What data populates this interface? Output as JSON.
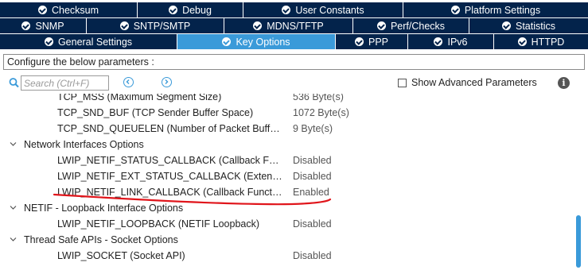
{
  "tabs": {
    "row1": [
      {
        "label": "Checksum"
      },
      {
        "label": "Debug"
      },
      {
        "label": "User Constants"
      },
      {
        "label": "Platform Settings"
      }
    ],
    "row2": [
      {
        "label": "SNMP"
      },
      {
        "label": "SNTP/SMTP"
      },
      {
        "label": "MDNS/TFTP"
      },
      {
        "label": "Perf/Checks"
      },
      {
        "label": "Statistics"
      }
    ],
    "row3": [
      {
        "label": "General Settings"
      },
      {
        "label": "Key Options"
      },
      {
        "label": "PPP"
      },
      {
        "label": "IPv6"
      },
      {
        "label": "HTTPD"
      }
    ],
    "active": "Key Options"
  },
  "configure_label": "Configure the below parameters :",
  "search": {
    "placeholder": "Search (Ctrl+F)"
  },
  "show_advanced": {
    "label": "Show Advanced Parameters",
    "checked": false
  },
  "tree": {
    "rows": [
      {
        "name": "TCP_MSS (Maximum Segment Size)",
        "value": "536 Byte(s)"
      },
      {
        "name": "TCP_SND_BUF (TCP Sender Buffer Space)",
        "value": "1072 Byte(s)"
      },
      {
        "name": "TCP_SND_QUEUELEN (Number of Packet Buff…",
        "value": "9 Byte(s)"
      },
      {
        "name": "Network Interfaces Options",
        "value": ""
      },
      {
        "name": "LWIP_NETIF_STATUS_CALLBACK (Callback F…",
        "value": "Disabled"
      },
      {
        "name": "LWIP_NETIF_EXT_STATUS_CALLBACK (Exten…",
        "value": "Disabled"
      },
      {
        "name": "LWIP_NETIF_LINK_CALLBACK (Callback Funct…",
        "value": "Enabled"
      },
      {
        "name": "NETIF - Loopback Interface Options",
        "value": ""
      },
      {
        "name": "LWIP_NETIF_LOOPBACK (NETIF Loopback)",
        "value": "Disabled"
      },
      {
        "name": "Thread Safe APIs - Socket Options",
        "value": ""
      },
      {
        "name": "LWIP_SOCKET (Socket API)",
        "value": "Disabled"
      }
    ]
  },
  "colors": {
    "tab_bg": "#03234b",
    "tab_active": "#3a9ad9",
    "annotation": "#e0151b"
  }
}
